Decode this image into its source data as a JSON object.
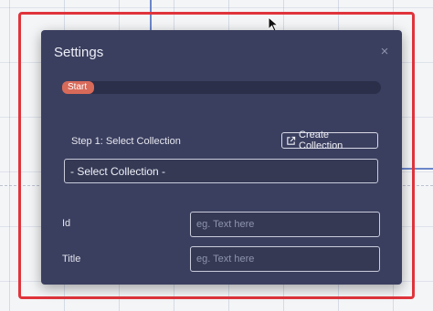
{
  "dialog": {
    "title": "Settings",
    "close_icon": "×"
  },
  "progress": {
    "label": "Start",
    "value_percent": 10
  },
  "step": {
    "label": "Step 1: Select Collection",
    "create_label": "Create Collection",
    "create_icon": "external-link-icon"
  },
  "collection_select": {
    "selected": "- Select Collection -"
  },
  "fields": {
    "id": {
      "label": "Id",
      "placeholder": "eg. Text here",
      "value": ""
    },
    "title": {
      "label": "Title",
      "placeholder": "eg. Text here",
      "value": ""
    }
  },
  "colors": {
    "dialog_bg": "#3b3f5f",
    "progress_accent": "#d86a5a",
    "highlight_border": "#e0343c"
  }
}
